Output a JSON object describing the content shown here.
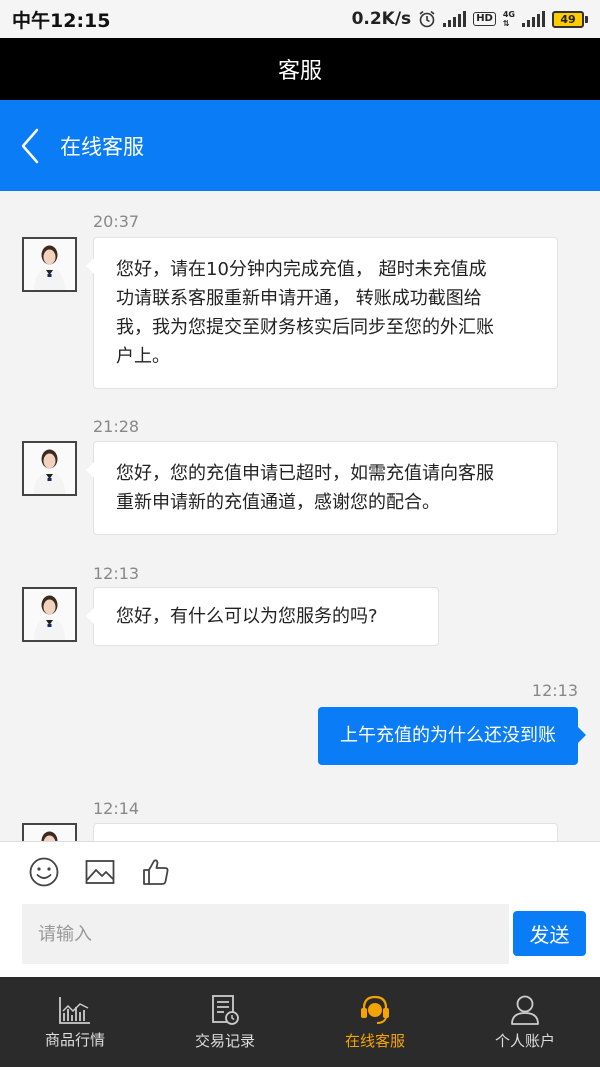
{
  "status_bar": {
    "time": "中午12:15",
    "speed": "0.2K/s",
    "hd": "HD",
    "net_top": "4G",
    "battery": "49"
  },
  "app_title": "客服",
  "header": {
    "title": "在线客服"
  },
  "messages": [
    {
      "time": "20:37",
      "text_lines": [
        "您好，请在10分钟内完成充值， 超时未充值成",
        "功请联系客服重新申请开通， 转账成功截图给",
        "我，我为您提交至财务核实后同步至您的外汇账",
        "户上。"
      ]
    },
    {
      "time": "21:28",
      "text_lines": [
        "您好，您的充值申请已超时，如需充值请向客服",
        "重新申请新的充值通道，感谢您的配合。"
      ]
    },
    {
      "time": "12:13",
      "text_lines": [
        "您好，有什么可以为您服务的吗?"
      ]
    },
    {
      "time": "12:13",
      "text": "上午充值的为什么还没到账"
    },
    {
      "time": "12:14"
    }
  ],
  "input": {
    "placeholder": "请输入",
    "send_label": "发送"
  },
  "tools": [
    "smile-icon",
    "image-icon",
    "thumbs-up-icon"
  ],
  "nav": [
    {
      "label": "商品行情",
      "icon": "chart-icon",
      "active": false
    },
    {
      "label": "交易记录",
      "icon": "record-icon",
      "active": false
    },
    {
      "label": "在线客服",
      "icon": "service-icon",
      "active": true
    },
    {
      "label": "个人账户",
      "icon": "user-icon",
      "active": false
    }
  ],
  "colors": {
    "accent": "#0a7cf5",
    "active_nav": "#f5a300",
    "nav_bg": "#2b2b2b"
  }
}
